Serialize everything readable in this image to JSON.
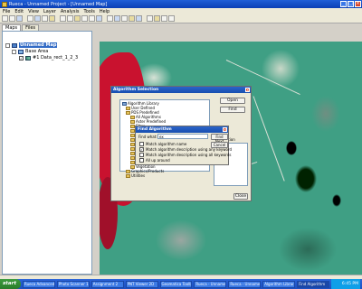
{
  "window": {
    "title": "Rueca - Unnamed Project - [Unnamed Map]"
  },
  "menu": [
    "File",
    "Edit",
    "View",
    "Layer",
    "Analysis",
    "Tools",
    "Help"
  ],
  "left_panel": {
    "tabs": [
      "Maps",
      "Files"
    ],
    "tree": {
      "root": "Unnamed Map",
      "group": "Base Area",
      "layer": "#1 Data_rect_1_2_3"
    }
  },
  "algo_dialog": {
    "title": "Algorithm Selection",
    "items": [
      "Algorithm Library",
      "User Defined",
      "PDS Predefined",
      "All Algorithms",
      "Aster Predefined",
      "Filter",
      "Image Analysis",
      "Radiometric",
      "Reduction",
      "Risk Algorithms",
      "Spatial",
      "Surface",
      "Terrain",
      "Transforms",
      "Vegetation",
      "Graphics/Products",
      "Utilities"
    ],
    "buttons": {
      "open": "Open",
      "find": "Find",
      "close": "Close"
    },
    "side_label": "Description"
  },
  "find_dialog": {
    "title": "Find Algorithm",
    "label": "Find what:",
    "query": "ex",
    "find_next": "Find Next",
    "cancel": "Cancel",
    "options": [
      "Match algorithm name",
      "Match algorithm description using any keyword",
      "Match algorithm description using all keywords",
      "All up around"
    ],
    "checked": [
      false,
      true,
      false,
      false
    ]
  },
  "taskbar": {
    "start": "start",
    "tasks": [
      "Rueca Advanced",
      "Photo Scanner 1",
      "Assignment 2",
      "PNT Viewer 2D",
      "Geomatica Toolb...",
      "Rueca - Unname...",
      "Rueca - Unname...",
      "Algorithm Librar...",
      "Find Algorithm"
    ],
    "active": 8,
    "clock": "6:45 PM"
  }
}
